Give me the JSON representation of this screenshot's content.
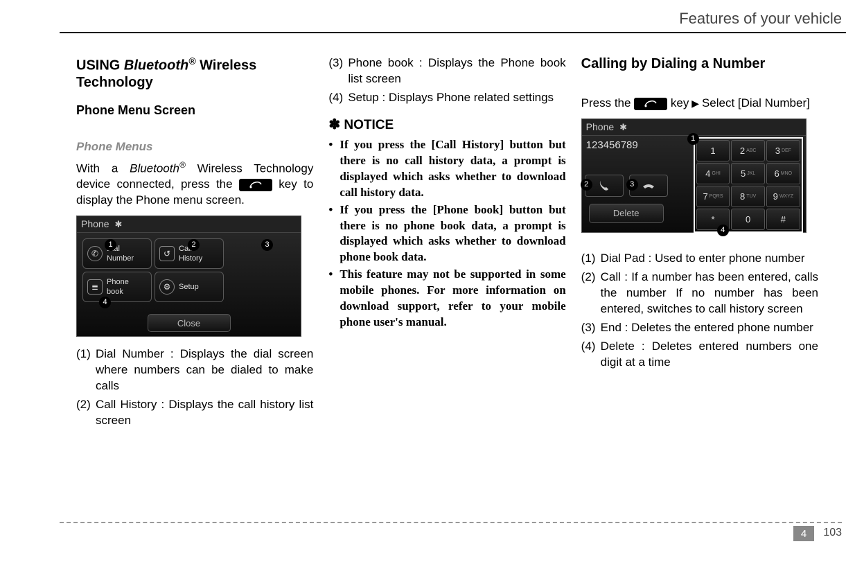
{
  "header": {
    "title": "Features of your vehicle"
  },
  "footer": {
    "section": "4",
    "page": "103"
  },
  "col1": {
    "h2_a": "USING ",
    "h2_b": "Bluetooth",
    "h2_c": "®",
    "h2_d": "  Wireless Technology",
    "h3": "Phone Menu Screen",
    "h4": "Phone Menus",
    "intro_a": "With a ",
    "intro_b": "Bluetooth",
    "intro_c": "®",
    "intro_d": " Wireless Technology device connected, press the ",
    "intro_e": " key to display the Phone menu screen.",
    "shot": {
      "title": "Phone",
      "btn1a": "Dial",
      "btn1b": "Number",
      "btn2a": "Call",
      "btn2b": "History",
      "btn3a": "Phone",
      "btn3b": "book",
      "btn4": "Setup",
      "close": "Close"
    },
    "li1n": "(1)",
    "li1t": "Dial Number : Displays the dial screen where numbers can be dialed to make calls",
    "li2n": "(2)",
    "li2t": "Call History : Displays the call history list screen"
  },
  "col2": {
    "li3n": "(3)",
    "li3t": "Phone book : Displays the Phone book list screen",
    "li4n": "(4)",
    "li4t": "Setup : Displays Phone related settings",
    "notice": "NOTICE",
    "n1": "If you press the [Call History] button but there is no call history data, a prompt is displayed which asks whether to download call history data.",
    "n2": "If you press the [Phone book] button but there is no phone book data, a prompt is displayed which asks whether to download phone book data.",
    "n3": "This feature may not be supported in some mobile phones. For more information on download support, refer to your mobile phone user's manual."
  },
  "col3": {
    "h2": "Calling by Dialing a Number",
    "press_a": "Press the  ",
    "press_b": "  key",
    "press_c": "Select [Dial Number]",
    "shot": {
      "title": "Phone",
      "entered": "123456789",
      "delete": "Delete",
      "keys": [
        {
          "n": "1",
          "s": ""
        },
        {
          "n": "2",
          "s": "ABC"
        },
        {
          "n": "3",
          "s": "DEF"
        },
        {
          "n": "4",
          "s": "GHI"
        },
        {
          "n": "5",
          "s": "JKL"
        },
        {
          "n": "6",
          "s": "MNO"
        },
        {
          "n": "7",
          "s": "PQRS"
        },
        {
          "n": "8",
          "s": "TUV"
        },
        {
          "n": "9",
          "s": "WXYZ"
        },
        {
          "n": "*",
          "s": ""
        },
        {
          "n": "0",
          "s": ""
        },
        {
          "n": "#",
          "s": ""
        }
      ]
    },
    "li1n": "(1)",
    "li1t": "Dial Pad : Used to enter phone number",
    "li2n": "(2)",
    "li2t": "Call : If a number has been entered, calls the number If no number has been entered, switches to call history screen",
    "li3n": "(3)",
    "li3t": "End : Deletes the entered phone number",
    "li4n": "(4)",
    "li4t": "Delete : Deletes entered numbers one digit at a time"
  }
}
